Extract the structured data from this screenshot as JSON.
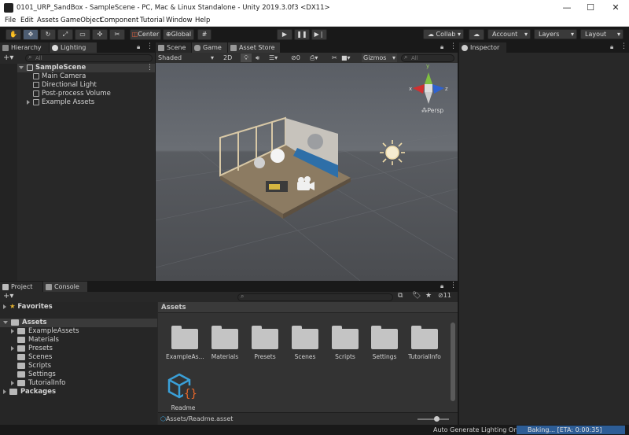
{
  "window": {
    "title": "0101_URP_SandBox - SampleScene - PC, Mac & Linux Standalone - Unity 2019.3.0f3 <DX11>"
  },
  "menu": [
    "File",
    "Edit",
    "Assets",
    "GameObject",
    "Component",
    "Tutorial",
    "Window",
    "Help"
  ],
  "toolbar": {
    "center_label": "Center",
    "global_label": "Global",
    "collab_label": "Collab",
    "account_label": "Account",
    "layers_label": "Layers",
    "layout_label": "Layout"
  },
  "hierarchy": {
    "tab_label": "Hierarchy",
    "lighting_tab_label": "Lighting",
    "search_placeholder": "All",
    "scene_name": "SampleScene",
    "items": [
      "Main Camera",
      "Directional Light",
      "Post-process Volume",
      "Example Assets"
    ]
  },
  "scene": {
    "tabs": [
      "Scene",
      "Game",
      "Asset Store"
    ],
    "shading_mode": "Shaded",
    "mode_2d": "2D",
    "hidden_count": "0",
    "gizmos_label": "Gizmos",
    "search_placeholder": "All",
    "persp_label": "Persp",
    "axes": {
      "x": "x",
      "y": "y",
      "z": "z"
    }
  },
  "inspector": {
    "tab_label": "Inspector"
  },
  "project": {
    "tab_label": "Project",
    "console_tab_label": "Console",
    "favorites_label": "Favorites",
    "assets_label": "Assets",
    "packages_label": "Packages",
    "tree": [
      "ExampleAssets",
      "Materials",
      "Presets",
      "Scenes",
      "Scripts",
      "Settings",
      "TutorialInfo"
    ],
    "breadcrumb": "Assets",
    "grid_items": [
      "ExampleAs...",
      "Materials",
      "Presets",
      "Scenes",
      "Scripts",
      "Settings",
      "TutorialInfo"
    ],
    "readme_label": "Readme",
    "hidden_count": "11",
    "selected_path": "Assets/Readme.asset",
    "zoom_slider": 0.6
  },
  "status": {
    "auto_lighting": "Auto Generate Lighting On",
    "baking": "Baking... [ETA: 0:00:35]"
  },
  "colors": {
    "accent": "#4d7ab8",
    "baking_bar": "#2d5d96",
    "readme_icon": "#3aa0d8",
    "readme_braces": "#e8682a"
  }
}
